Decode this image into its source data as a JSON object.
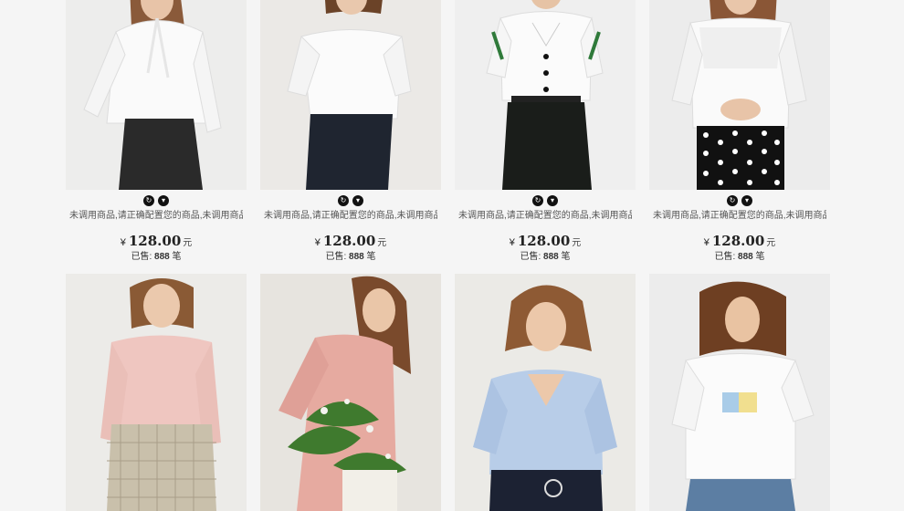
{
  "products_row1": [
    {
      "title": "未调用商品,请正确配置您的商品,未调用商品,请正确配置您的商品",
      "currency": "¥",
      "price": "128.00",
      "unit": "元",
      "sold_label": "已售:",
      "sold_count": "888",
      "sold_unit": "笔",
      "icons": [
        "refresh-icon",
        "cart-icon"
      ]
    },
    {
      "title": "未调用商品,请正确配置您的商品,未调用商品,请正确配置您的商品",
      "currency": "¥",
      "price": "128.00",
      "unit": "元",
      "sold_label": "已售:",
      "sold_count": "888",
      "sold_unit": "笔",
      "icons": [
        "refresh-icon",
        "cart-icon"
      ]
    },
    {
      "title": "未调用商品,请正确配置您的商品,未调用商品,请正确配置您的商品",
      "currency": "¥",
      "price": "128.00",
      "unit": "元",
      "sold_label": "已售:",
      "sold_count": "888",
      "sold_unit": "笔",
      "icons": [
        "refresh-icon",
        "cart-icon"
      ]
    },
    {
      "title": "未调用商品,请正确配置您的商品,未调用商品,请正确配置您的商品",
      "currency": "¥",
      "price": "128.00",
      "unit": "元",
      "sold_label": "已售:",
      "sold_count": "888",
      "sold_unit": "笔",
      "icons": [
        "refresh-icon",
        "cart-icon"
      ]
    }
  ],
  "colors": {
    "background": "#f5f5f5",
    "text": "#222222",
    "icon_bg": "#111111"
  }
}
